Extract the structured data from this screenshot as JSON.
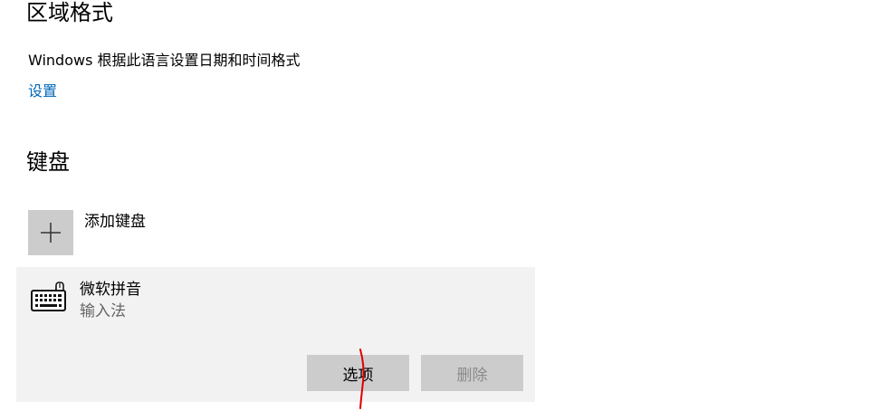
{
  "region_format": {
    "title": "区域格式",
    "description": "Windows 根据此语言设置日期和时间格式",
    "settings_link": "设置"
  },
  "keyboard": {
    "title": "键盘",
    "add_label": "添加键盘",
    "add_icon": "plus-icon",
    "items": [
      {
        "name": "微软拼音",
        "type": "输入法",
        "icon": "keyboard-icon",
        "options_label": "选项",
        "remove_label": "删除"
      }
    ]
  },
  "colors": {
    "link": "#0067b8",
    "panel_bg": "#f2f2f2",
    "button_bg": "#cccccc",
    "disabled_text": "#8a8a8a",
    "annotation_stroke": "#e00000"
  }
}
